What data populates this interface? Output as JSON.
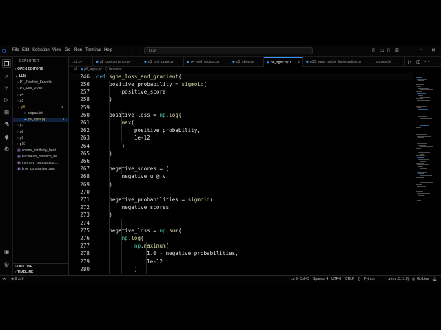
{
  "titlebar": {
    "menus": [
      "File",
      "Edit",
      "Selection",
      "View",
      "Go",
      "Run",
      "Terminal",
      "Help"
    ],
    "search_text": "LLM"
  },
  "sidebar": {
    "title": "EXPLORER",
    "open_editors": "OPEN EDITORS",
    "root": "LLM",
    "items": [
      {
        "label": "P1_OneHot_Encoder",
        "type": "folder"
      },
      {
        "label": "P3_PMI_PPMI",
        "type": "folder"
      },
      {
        "label": "p4",
        "type": "folder"
      },
      {
        "label": "p5",
        "type": "folder"
      },
      {
        "label": "p6",
        "type": "folder-open"
      },
      {
        "label": "corpus.txt",
        "type": "file"
      },
      {
        "label": "p6_sgns.py",
        "type": "file-py"
      },
      {
        "label": "p7",
        "type": "folder"
      },
      {
        "label": "p8",
        "type": "folder"
      },
      {
        "label": "p9",
        "type": "folder"
      },
      {
        "label": "p10",
        "type": "folder"
      },
      {
        "label": "cosine_similarity_heat...",
        "type": "image"
      },
      {
        "label": "euclidean_distance_he...",
        "type": "image"
      },
      {
        "label": "memory_comparison....",
        "type": "image"
      },
      {
        "label": "time_comparison.png",
        "type": "image"
      }
    ],
    "p6_badge": "●",
    "sgns_badge": "1",
    "outline": "OUTLINE",
    "timeline": "TIMELINE"
  },
  "tabs": [
    {
      "label": "...ot.py",
      "active": false
    },
    {
      "label": "p2_cooccurrence.py",
      "active": false
    },
    {
      "label": "p3_pmi_ppmi.py",
      "active": false
    },
    {
      "label": "p4_svd_vectors.py",
      "active": false
    },
    {
      "label": "p5_cbow.py",
      "active": false
    },
    {
      "label": "p6_sgns.py 1",
      "active": true
    },
    {
      "label": "p10_sgns_matrix_factorization.py",
      "active": false
    },
    {
      "label": "corpus.txt",
      "active": false
    }
  ],
  "breadcrumb": [
    "p6",
    "p6_sgns.py",
    "tokenize"
  ],
  "editor": {
    "sticky": {
      "num": "246",
      "code": "def sgns_loss_and_gradient("
    },
    "lines": [
      {
        "num": "256",
        "code": "    positive_probability = sigmoid("
      },
      {
        "num": "257",
        "code": "        positive_score"
      },
      {
        "num": "258",
        "code": "    )"
      },
      {
        "num": "259",
        "code": ""
      },
      {
        "num": "260",
        "code": "    positive_loss = np.log("
      },
      {
        "num": "261",
        "code": "        max("
      },
      {
        "num": "262",
        "code": "            positive_probability,"
      },
      {
        "num": "263",
        "code": "            1e-12"
      },
      {
        "num": "264",
        "code": "        )"
      },
      {
        "num": "265",
        "code": "    )"
      },
      {
        "num": "266",
        "code": ""
      },
      {
        "num": "267",
        "code": "    negative_scores = ("
      },
      {
        "num": "268",
        "code": "        negative_u @ v"
      },
      {
        "num": "269",
        "code": "    )"
      },
      {
        "num": "270",
        "code": ""
      },
      {
        "num": "271",
        "code": "    negative_probabilities = sigmoid("
      },
      {
        "num": "272",
        "code": "        negative_scores"
      },
      {
        "num": "273",
        "code": "    )"
      },
      {
        "num": "274",
        "code": ""
      },
      {
        "num": "275",
        "code": "    negative_loss = np.sum("
      },
      {
        "num": "276",
        "code": "        np.log("
      },
      {
        "num": "277",
        "code": "            np.maximum("
      },
      {
        "num": "278",
        "code": "                1.0 - negative_probabilities,"
      },
      {
        "num": "279",
        "code": "                1e-12"
      },
      {
        "num": "280",
        "code": "            )"
      }
    ]
  },
  "statusbar": {
    "problems": "⊗ 0 ⚠ 0",
    "cursor": "Ln 9, Col 43",
    "spaces": "Spaces: 4",
    "encoding": "UTF-8",
    "eol": "CRLF",
    "language": "Python",
    "env": ".venv (3.11.0)",
    "golive": "Go Live"
  }
}
